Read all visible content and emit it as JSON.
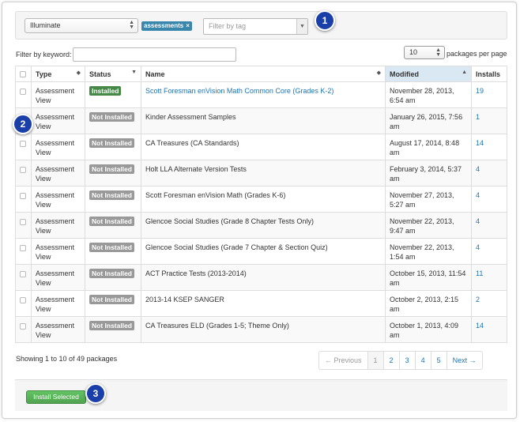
{
  "filter": {
    "source_select": "Illuminate",
    "tag_chip": "assessments",
    "tag_remove": "×",
    "tag_placeholder": "Filter by tag",
    "keyword_label": "Filter by keyword:",
    "per_page_value": "10",
    "per_page_label": "packages per page"
  },
  "callouts": [
    "1",
    "2",
    "3"
  ],
  "table": {
    "headers": [
      "Type",
      "Status",
      "Name",
      "Modified",
      "Installs"
    ],
    "rows": [
      {
        "type": "Assessment View",
        "status": "Installed",
        "name": "Scott Foresman enVision Math Common Core (Grades K-2)",
        "modified": "November 28, 2013, 6:54 am",
        "installs": "19"
      },
      {
        "type": "Assessment View",
        "status": "Not Installed",
        "name": "Kinder Assessment Samples",
        "modified": "January 26, 2015, 7:56 am",
        "installs": "1"
      },
      {
        "type": "Assessment View",
        "status": "Not Installed",
        "name": "CA Treasures (CA Standards)",
        "modified": "August 17, 2014, 8:48 am",
        "installs": "14"
      },
      {
        "type": "Assessment View",
        "status": "Not Installed",
        "name": "Holt LLA Alternate Version Tests",
        "modified": "February 3, 2014, 5:37 am",
        "installs": "4"
      },
      {
        "type": "Assessment View",
        "status": "Not Installed",
        "name": "Scott Foresman enVision Math (Grades K-6)",
        "modified": "November 27, 2013, 5:27 am",
        "installs": "4"
      },
      {
        "type": "Assessment View",
        "status": "Not Installed",
        "name": "Glencoe Social Studies (Grade 8 Chapter Tests Only)",
        "modified": "November 22, 2013, 9:47 am",
        "installs": "4"
      },
      {
        "type": "Assessment View",
        "status": "Not Installed",
        "name": "Glencoe Social Studies (Grade 7 Chapter & Section Quiz)",
        "modified": "November 22, 2013, 1:54 am",
        "installs": "4"
      },
      {
        "type": "Assessment View",
        "status": "Not Installed",
        "name": "ACT Practice Tests (2013-2014)",
        "modified": "October 15, 2013, 11:54 am",
        "installs": "11"
      },
      {
        "type": "Assessment View",
        "status": "Not Installed",
        "name": "2013-14 KSEP SANGER",
        "modified": "October 2, 2013, 2:15 am",
        "installs": "2"
      },
      {
        "type": "Assessment View",
        "status": "Not Installed",
        "name": "CA Treasures ELD (Grades 1-5; Theme Only)",
        "modified": "October 1, 2013, 4:09 am",
        "installs": "14"
      }
    ]
  },
  "footer": {
    "showing": "Showing 1 to 10 of 49 packages",
    "pager": [
      "← Previous",
      "1",
      "2",
      "3",
      "4",
      "5",
      "Next →"
    ],
    "install_button": "Install Selected"
  },
  "colors": {
    "installed": "#468847",
    "not_installed": "#999999",
    "link": "#1a75b8",
    "tag_chip": "#3a87ad",
    "callout": "#1a3fa8",
    "button": "#51a351"
  }
}
